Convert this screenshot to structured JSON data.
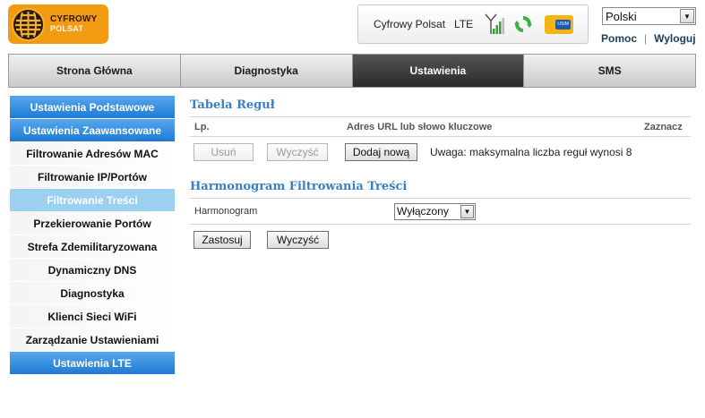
{
  "header": {
    "logo": {
      "brand_line1": "CYFROWY",
      "brand_line2": "POLSAT"
    },
    "status": {
      "operator": "Cyfrowy Polsat",
      "network": "LTE",
      "signal_icon": "antenna-signal-icon",
      "sync_icon": "refresh-arrows-icon",
      "sim_label": "USIM",
      "sim_color": "#f4b514"
    },
    "language": {
      "selected": "Polski"
    },
    "links": {
      "help": "Pomoc",
      "logout": "Wyloguj"
    }
  },
  "mainnav": {
    "tabs": [
      {
        "label": "Strona Główna",
        "active": false
      },
      {
        "label": "Diagnostyka",
        "active": false
      },
      {
        "label": "Ustawienia",
        "active": true
      },
      {
        "label": "SMS",
        "active": false
      }
    ]
  },
  "sidebar": {
    "items": [
      {
        "label": "Ustawienia Podstawowe",
        "style": "blue"
      },
      {
        "label": "Ustawienia Zaawansowane",
        "style": "blue"
      },
      {
        "label": "Filtrowanie Adresów MAC",
        "style": "plain"
      },
      {
        "label": "Filtrowanie IP/Portów",
        "style": "plain"
      },
      {
        "label": "Filtrowanie Treści",
        "style": "light"
      },
      {
        "label": "Przekierowanie Portów",
        "style": "plain"
      },
      {
        "label": "Strefa Zdemilitaryzowana",
        "style": "plain"
      },
      {
        "label": "Dynamiczny DNS",
        "style": "plain"
      },
      {
        "label": "Diagnostyka",
        "style": "plain"
      },
      {
        "label": "Klienci Sieci WiFi",
        "style": "plain"
      },
      {
        "label": "Zarządzanie Ustawieniami",
        "style": "plain"
      },
      {
        "label": "Ustawienia LTE",
        "style": "blue"
      }
    ]
  },
  "rules": {
    "title": "Tabela Reguł",
    "columns": {
      "lp": "Lp.",
      "url": "Adres URL lub słowo kluczowe",
      "mark": "Zaznacz"
    },
    "buttons": {
      "delete": "Usuń",
      "clear": "Wyczyść",
      "add": "Dodaj nową"
    },
    "note": "Uwaga: maksymalna liczba reguł wynosi 8"
  },
  "schedule": {
    "title": "Harmonogram Filtrowania Treści",
    "label": "Harmonogram",
    "selected": "Wyłączony",
    "buttons": {
      "apply": "Zastosuj",
      "clear": "Wyczyść"
    }
  },
  "colors": {
    "accent_blue": "#1f7ad2",
    "title_blue": "#3a7fc4",
    "active_tab": "#2a2a2a",
    "logo_orange": "#f29a12"
  }
}
